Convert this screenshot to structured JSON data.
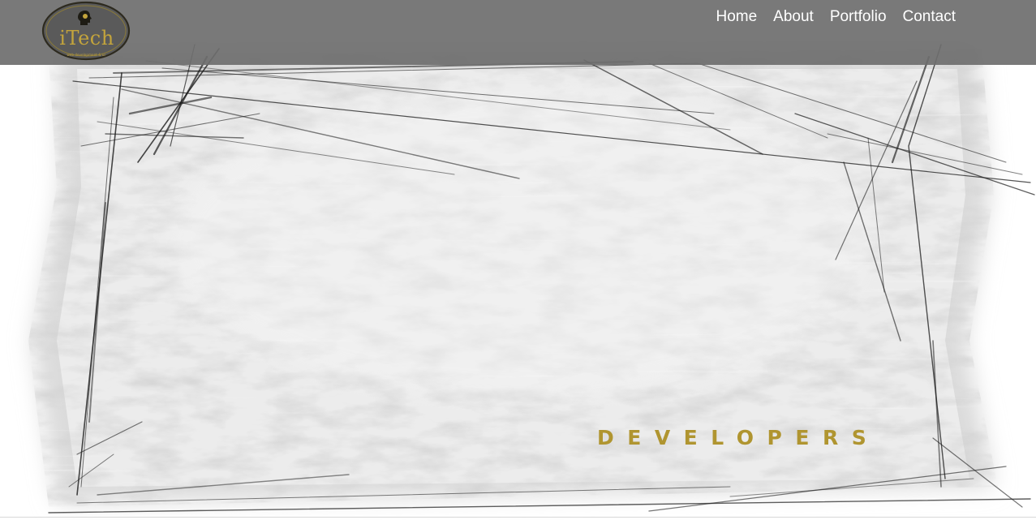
{
  "brand": {
    "logo_text": "iTech",
    "logo_subtitle": "web development & ui"
  },
  "nav": {
    "items": [
      {
        "label": "Home"
      },
      {
        "label": "About"
      },
      {
        "label": "Portfolio"
      },
      {
        "label": "Contact"
      }
    ]
  },
  "hero": {
    "tagline": "DEVELOPERS"
  },
  "colors": {
    "navbar_bg": "#6e6e6e",
    "nav_text": "#ffffff",
    "accent_gold": "#b09530",
    "logo_gold": "#c3a43c"
  }
}
